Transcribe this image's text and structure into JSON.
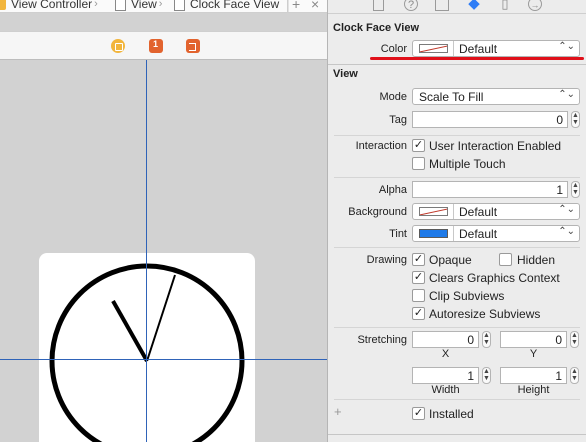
{
  "jumpbar": {
    "items": [
      "View Controller",
      "View",
      "Clock Face View"
    ],
    "add_icon": "plus-icon",
    "close_icon": "close-icon"
  },
  "dock": {
    "icons": [
      "view-controller-icon",
      "first-responder-icon",
      "exit-icon"
    ]
  },
  "inspector": {
    "tabs": [
      "file-inspector-icon",
      "quick-help-icon",
      "identity-inspector-icon",
      "attributes-inspector-icon",
      "size-inspector-icon",
      "connections-inspector-icon"
    ],
    "clock_section": {
      "title": "Clock Face View",
      "color_label": "Color",
      "color_value": "Default"
    },
    "view_section": {
      "title": "View",
      "mode_label": "Mode",
      "mode_value": "Scale To Fill",
      "tag_label": "Tag",
      "tag_value": "0",
      "interaction_label": "Interaction",
      "user_interaction": "User Interaction Enabled",
      "multiple_touch": "Multiple Touch",
      "alpha_label": "Alpha",
      "alpha_value": "1",
      "background_label": "Background",
      "background_value": "Default",
      "tint_label": "Tint",
      "tint_value": "Default",
      "drawing_label": "Drawing",
      "opaque": "Opaque",
      "hidden": "Hidden",
      "clears_graphics": "Clears Graphics Context",
      "clip_subviews": "Clip Subviews",
      "autoresize_subviews": "Autoresize Subviews",
      "stretching_label": "Stretching",
      "stretch_x_value": "0",
      "stretch_y_value": "0",
      "stretch_x_label": "X",
      "stretch_y_label": "Y",
      "stretch_w_value": "1",
      "stretch_h_value": "1",
      "width_label": "Width",
      "height_label": "Height",
      "installed": "Installed"
    }
  },
  "checkbox_states": {
    "user_interaction": true,
    "multiple_touch": false,
    "opaque": true,
    "hidden": false,
    "clears_graphics": true,
    "clip_subviews": false,
    "autoresize_subviews": true,
    "installed": true
  },
  "colors": {
    "guide": "#2f63b8",
    "highlight": "#e0101a",
    "tint": "#1f7ae8",
    "accent": "#2f7df6"
  }
}
